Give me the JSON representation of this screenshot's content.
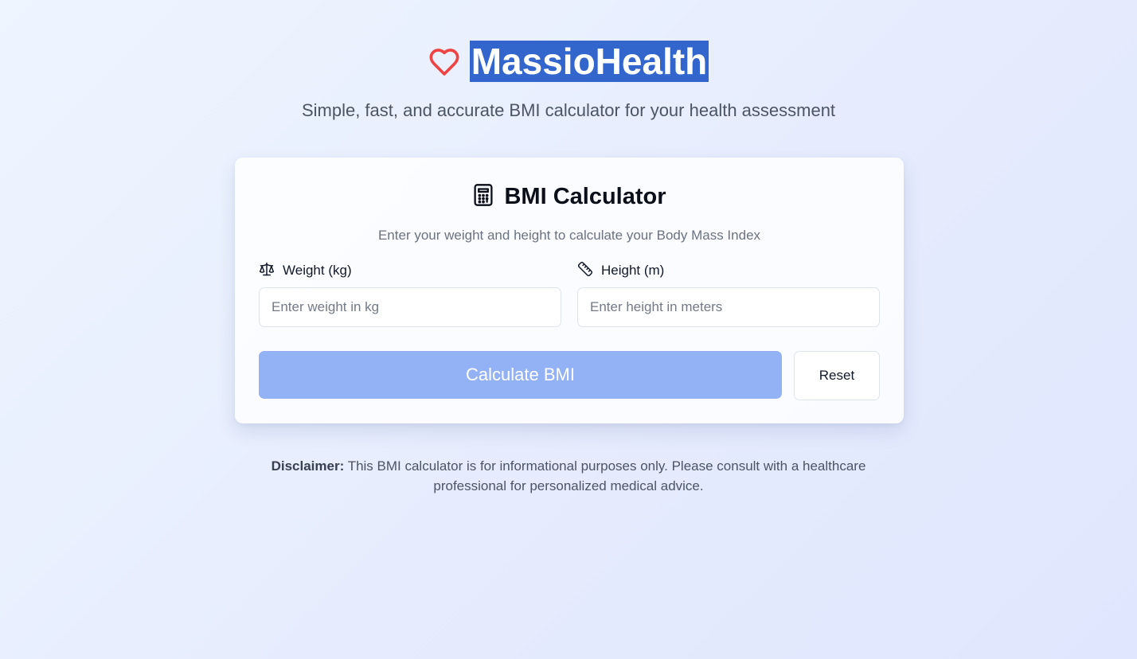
{
  "header": {
    "icon": "heart-icon",
    "brand_title": "MassioHealth",
    "subtitle": "Simple, fast, and accurate BMI calculator for your health assessment"
  },
  "calculator": {
    "icon": "calculator-icon",
    "title": "BMI Calculator",
    "description": "Enter your weight and height to calculate your Body Mass Index",
    "weight": {
      "icon": "scale-icon",
      "label": "Weight (kg)",
      "value": "",
      "placeholder": "Enter weight in kg"
    },
    "height": {
      "icon": "ruler-icon",
      "label": "Height (m)",
      "value": "",
      "placeholder": "Enter height in meters"
    },
    "calculate_label": "Calculate BMI",
    "reset_label": "Reset"
  },
  "disclaimer": {
    "label": "Disclaimer:",
    "text": "This BMI calculator is for informational purposes only. Please consult with a healthcare professional for personalized medical advice."
  },
  "colors": {
    "heart": "#ef4444",
    "brand_highlight": "#3366cc",
    "primary_button": "#93b1f5"
  }
}
